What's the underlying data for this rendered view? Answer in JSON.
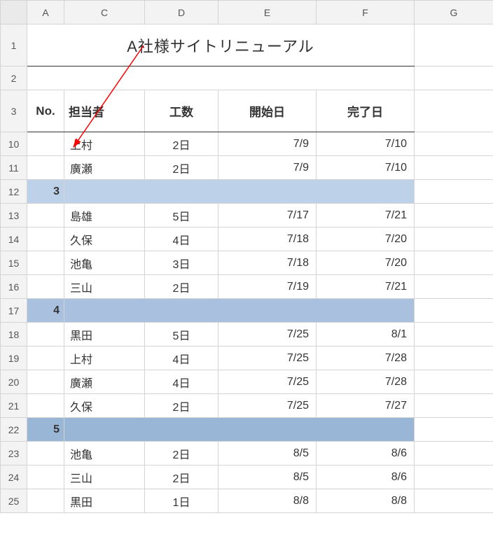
{
  "columns": {
    "A": "A",
    "C": "C",
    "D": "D",
    "E": "E",
    "F": "F",
    "G": "G"
  },
  "row_labels": {
    "r1": "1",
    "r2": "2",
    "r3": "3",
    "r10": "10",
    "r11": "11",
    "r12": "12",
    "r13": "13",
    "r14": "14",
    "r15": "15",
    "r16": "16",
    "r17": "17",
    "r18": "18",
    "r19": "19",
    "r20": "20",
    "r21": "21",
    "r22": "22",
    "r23": "23",
    "r24": "24",
    "r25": "25"
  },
  "title": "A社様サイトリニューアル",
  "headers": {
    "no": "No.",
    "person": "担当者",
    "effort": "工数",
    "start": "開始日",
    "end": "完了日"
  },
  "rows": {
    "r10": {
      "person": "上村",
      "effort": "2日",
      "start": "7/9",
      "end": "7/10"
    },
    "r11": {
      "person": "廣瀬",
      "effort": "2日",
      "start": "7/9",
      "end": "7/10"
    },
    "r12": {
      "no": "3"
    },
    "r13": {
      "person": "島雄",
      "effort": "5日",
      "start": "7/17",
      "end": "7/21"
    },
    "r14": {
      "person": "久保",
      "effort": "4日",
      "start": "7/18",
      "end": "7/20"
    },
    "r15": {
      "person": "池亀",
      "effort": "3日",
      "start": "7/18",
      "end": "7/20"
    },
    "r16": {
      "person": "三山",
      "effort": "2日",
      "start": "7/19",
      "end": "7/21"
    },
    "r17": {
      "no": "4"
    },
    "r18": {
      "person": "黒田",
      "effort": "5日",
      "start": "7/25",
      "end": "8/1"
    },
    "r19": {
      "person": "上村",
      "effort": "4日",
      "start": "7/25",
      "end": "7/28"
    },
    "r20": {
      "person": "廣瀬",
      "effort": "4日",
      "start": "7/25",
      "end": "7/28"
    },
    "r21": {
      "person": "久保",
      "effort": "2日",
      "start": "7/25",
      "end": "7/27"
    },
    "r22": {
      "no": "5"
    },
    "r23": {
      "person": "池亀",
      "effort": "2日",
      "start": "8/5",
      "end": "8/6"
    },
    "r24": {
      "person": "三山",
      "effort": "2日",
      "start": "8/5",
      "end": "8/6"
    },
    "r25": {
      "person": "黒田",
      "effort": "1日",
      "start": "8/8",
      "end": "8/8"
    }
  }
}
